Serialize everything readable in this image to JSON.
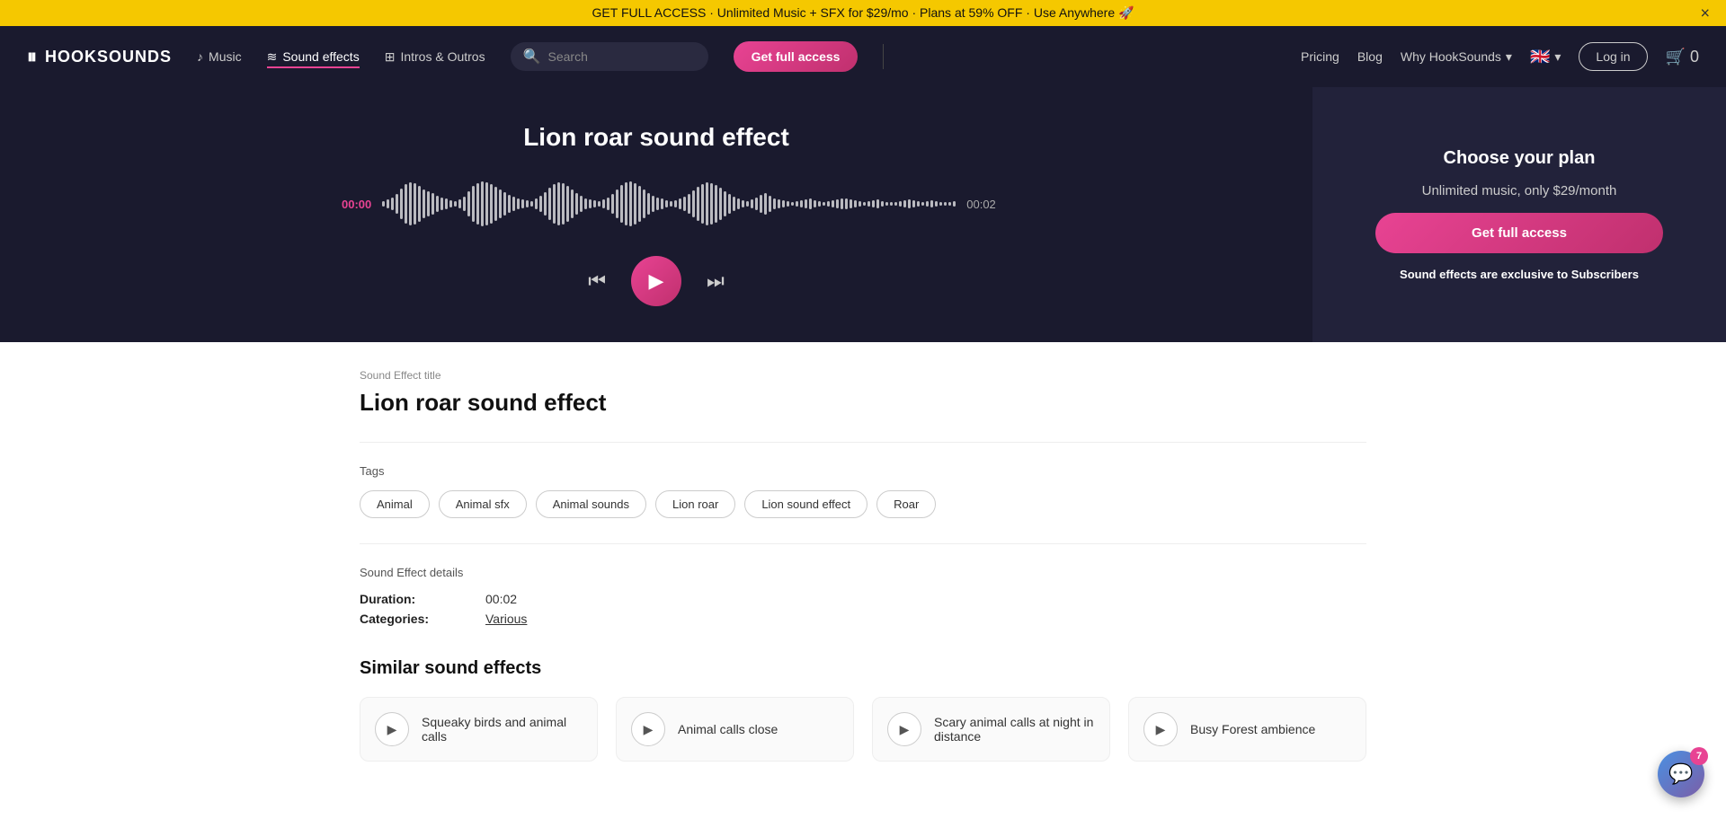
{
  "banner": {
    "text": "GET FULL ACCESS · Unlimited Music + SFX for $29/mo · Plans at 59% OFF · Use Anywhere 🚀",
    "close_label": "×"
  },
  "navbar": {
    "logo_text": "HOOKSOUNDS",
    "music_label": "Music",
    "sound_effects_label": "Sound effects",
    "intros_outros_label": "Intros & Outros",
    "search_placeholder": "Search",
    "get_full_access_label": "Get full access",
    "pricing_label": "Pricing",
    "blog_label": "Blog",
    "why_label": "Why HookSounds",
    "flag": "🇬🇧",
    "login_label": "Log in",
    "cart_count": "0"
  },
  "hero": {
    "title": "Lion roar sound effect",
    "time_start": "00:00",
    "time_end": "00:02",
    "plan_title": "Choose your plan",
    "plan_subtitle": "Unlimited music, only $29/month",
    "get_access_label": "Get full access",
    "plan_note": "Sound effects are exclusive to Subscribers"
  },
  "content": {
    "section_label": "Sound Effect title",
    "section_title": "Lion roar sound effect",
    "tags_label": "Tags",
    "tags": [
      "Animal",
      "Animal sfx",
      "Animal sounds",
      "Lion roar",
      "Lion sound effect",
      "Roar"
    ],
    "details_label": "Sound Effect details",
    "duration_key": "Duration:",
    "duration_val": "00:02",
    "categories_key": "Categories:",
    "categories_val": "Various"
  },
  "similar": {
    "title": "Similar sound effects",
    "items": [
      {
        "name": "Squeaky birds and animal calls"
      },
      {
        "name": "Animal calls close"
      },
      {
        "name": "Scary animal calls at night in distance"
      },
      {
        "name": "Busy Forest ambience"
      }
    ]
  },
  "chat": {
    "badge": "7"
  }
}
